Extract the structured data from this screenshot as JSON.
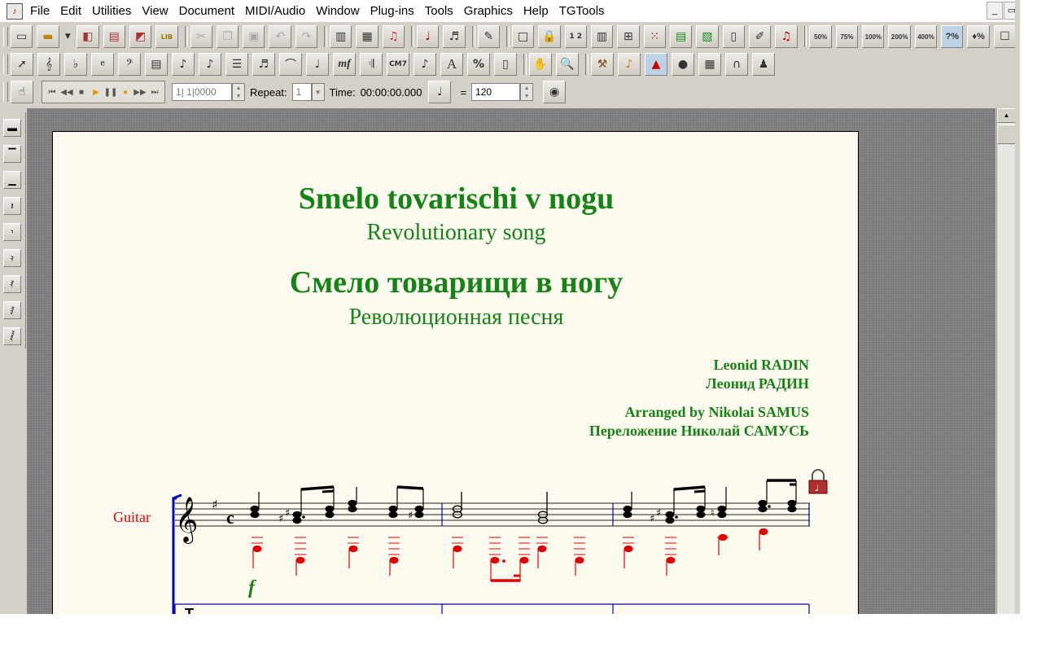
{
  "menu": [
    "File",
    "Edit",
    "Utilities",
    "View",
    "Document",
    "MIDI/Audio",
    "Window",
    "Plug-ins",
    "Tools",
    "Graphics",
    "Help",
    "TGTools"
  ],
  "window_controls": {
    "minimize": "_",
    "restore": "▭"
  },
  "toolbar_main": {
    "icons": [
      "new-document-icon",
      "open-folder-icon",
      "dropdown-arrow-icon",
      "save-icon",
      "print-icon",
      "library-open-icon",
      "library-icon",
      "cut-icon",
      "copy-icon",
      "paste-icon",
      "undo-icon",
      "redo-icon",
      "score-manager-icon",
      "page-view-icon",
      "mixer-icon",
      "playback-icon",
      "note-mover-icon",
      "microphone-icon",
      "frame-icon",
      "lock-icon",
      "measure-numbers-icon",
      "staff-icon",
      "grid-icon",
      "dotted-grid-icon",
      "layer-icon",
      "layer-alt-icon",
      "page-icon",
      "page-edit-icon",
      "music-note-icon"
    ],
    "zoom_labels": [
      "50%",
      "75%",
      "100%",
      "200%",
      "400%",
      "?%",
      "♦%"
    ]
  },
  "toolbar_tools": {
    "icons": [
      "selection-tool-icon",
      "staff-tool-icon",
      "key-signature-icon",
      "time-signature-icon",
      "clef-icon",
      "measure-tool-icon",
      "simple-entry-icon",
      "speedy-entry-icon",
      "hyperscribe-icon",
      "tuplet-icon",
      "smart-shape-icon",
      "articulation-icon",
      "expression-icon",
      "repeat-icon",
      "chord-icon",
      "lyrics-icon",
      "text-icon",
      "resize-icon",
      "special-tools-icon",
      "hand-grabber-icon",
      "zoom-tool-icon",
      "hammer-icon",
      "mirror-icon",
      "graphics-tool-icon",
      "note-shape-icon",
      "staff-styles-icon",
      "mass-edit-icon",
      "ossia-icon"
    ],
    "chord_label": "CM7",
    "expression_label": "mf",
    "text_label": "A",
    "resize_label": "%"
  },
  "toolbar_playback": {
    "measure_value": "1| 1|0000",
    "repeat_label": "Repeat:",
    "repeat_value": "1",
    "time_label": "Time:",
    "time_value": "00:00:00.000",
    "equals": "=",
    "tempo_value": "120"
  },
  "palette": [
    "breve-rest-icon",
    "whole-rest-icon",
    "half-rest-icon",
    "quarter-rest-icon",
    "eighth-rest-icon",
    "sixteenth-rest-icon",
    "thirty-second-rest-icon",
    "sixty-fourth-rest-icon",
    "hundred-twenty-eighth-rest-icon"
  ],
  "score": {
    "title": "Smelo tovarischi v nogu",
    "subtitle": "Revolutionary song",
    "title_ru": "Смело товарищи в ногу",
    "subtitle_ru": "Революционная песня",
    "composer": "Leonid RADIN",
    "composer_ru": "Леонид РАДИН",
    "arranger": "Arranged by Nikolai SAMUS",
    "arranger_ru": "Переложение Николай САМУСЬ",
    "instrument": "Guitar",
    "dynamic": "f",
    "time_signature": "c",
    "colors": {
      "title": "#168316",
      "instrument": "#e00000",
      "staff_frame": "#0000cc",
      "tab_notes": "#e00000"
    }
  }
}
